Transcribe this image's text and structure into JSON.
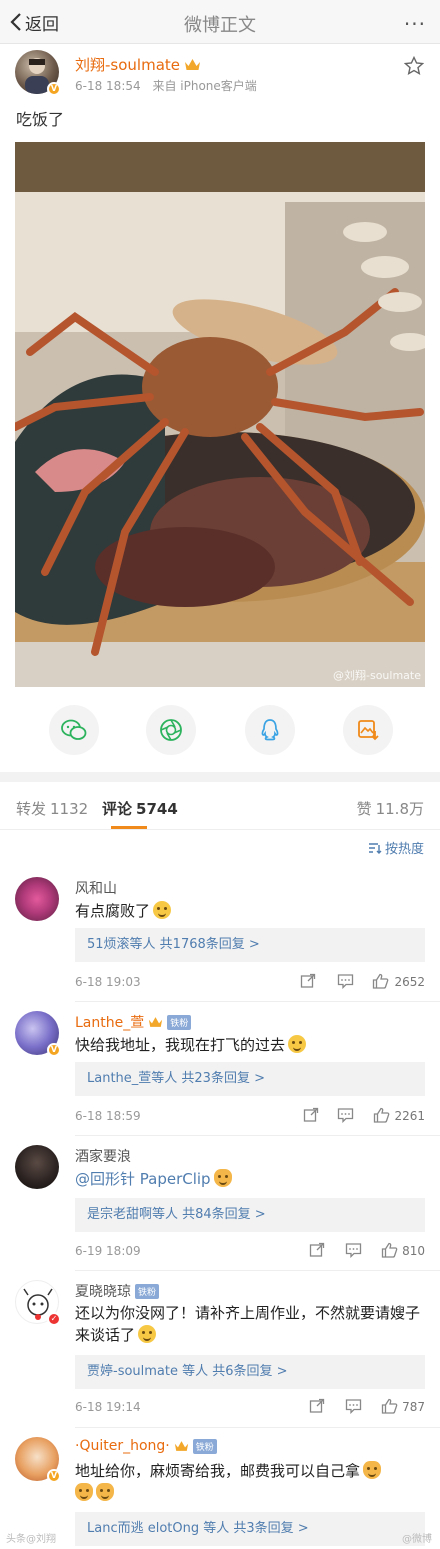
{
  "nav": {
    "back_label": "返回",
    "title": "微博正文",
    "more_label": "···"
  },
  "post": {
    "author": "刘翔-soulmate",
    "time": "6-18 18:54",
    "source": "来自 iPhone客户端",
    "text": "吃饭了",
    "image_watermark": "@刘翔-soulmate"
  },
  "share": [
    "wechat-icon",
    "moments-icon",
    "qq-icon",
    "save-image-icon"
  ],
  "tabs": {
    "repost_label": "转发",
    "repost_count": "1132",
    "comment_label": "评论",
    "comment_count": "5744",
    "like_label": "赞",
    "like_count": "11.8万"
  },
  "sort_label": "按热度",
  "comments": [
    {
      "name": "风和山",
      "text": "有点腐败了",
      "replies": "51烦滚等人  共1768条回复 >",
      "time": "6-18 19:03",
      "likes": "2652"
    },
    {
      "name": "Lanthe_萱",
      "badge": "铁粉",
      "text": "快给我地址，我现在打飞的过去",
      "replies": "Lanthe_萱等人  共23条回复 >",
      "time": "6-18 18:59",
      "likes": "2261"
    },
    {
      "name": "酒家要浪",
      "text": "@回形针 PaperClip",
      "replies": "是宗老甜啊等人  共84条回复 >",
      "time": "6-19 18:09",
      "likes": "810"
    },
    {
      "name": "夏晓晓琼",
      "badge": "铁粉",
      "text": "还以为你没网了！请补齐上周作业，不然就要请嫂子来谈话了",
      "replies": "贾婷-soulmate 等人  共6条回复 >",
      "time": "6-18 19:14",
      "likes": "787"
    },
    {
      "name": "·Quiter_hong·",
      "badge": "铁粉",
      "text": "地址给你，麻烦寄给我，邮费我可以自己拿",
      "replies": "Lanc而逃 elotOng 等人  共3条回复 >"
    }
  ],
  "footer": {
    "left": "头条@刘翔",
    "right": "@微博"
  },
  "colors": {
    "orange_name": "#e86b0f",
    "link_blue": "#507daf"
  }
}
